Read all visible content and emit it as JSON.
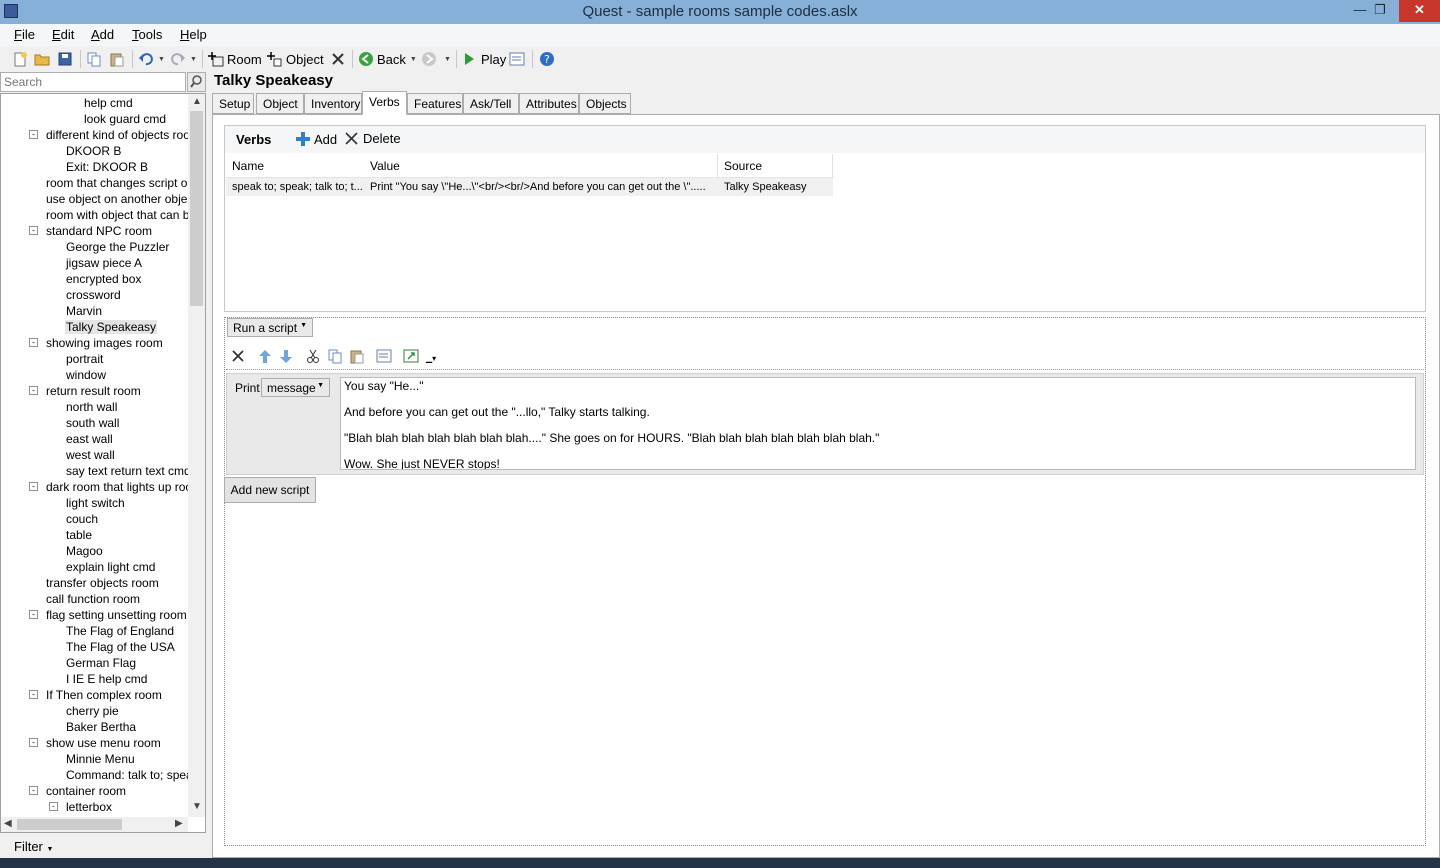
{
  "window": {
    "title": "Quest - sample rooms sample codes.aslx",
    "minimize": "—",
    "maximize": "❐",
    "close": "✕"
  },
  "menu": [
    {
      "acc": "F",
      "rest": "ile"
    },
    {
      "acc": "E",
      "rest": "dit"
    },
    {
      "acc": "A",
      "rest": "dd"
    },
    {
      "acc": "T",
      "rest": "ools"
    },
    {
      "acc": "H",
      "rest": "elp"
    }
  ],
  "toolbar": {
    "room_label": "Room",
    "object_label": "Object",
    "back_label": "Back",
    "play_label": "Play"
  },
  "search": {
    "placeholder": "Search"
  },
  "tree": [
    {
      "label": "help cmd",
      "level": 3
    },
    {
      "label": "look guard cmd",
      "level": 3
    },
    {
      "label": "different kind of objects room",
      "level": 1,
      "expander": "-"
    },
    {
      "label": "DKOOR B",
      "level": 2
    },
    {
      "label": "Exit: DKOOR B",
      "level": 2
    },
    {
      "label": "room that changes script once",
      "level": 1
    },
    {
      "label": "use object on another object n",
      "level": 1
    },
    {
      "label": "room with object that can be s",
      "level": 1
    },
    {
      "label": "standard NPC room",
      "level": 1,
      "expander": "-"
    },
    {
      "label": "George the Puzzler",
      "level": 2
    },
    {
      "label": "jigsaw piece A",
      "level": 2
    },
    {
      "label": "encrypted box",
      "level": 2
    },
    {
      "label": "crossword",
      "level": 2
    },
    {
      "label": "Marvin",
      "level": 2
    },
    {
      "label": "Talky Speakeasy",
      "level": 2,
      "selected": true
    },
    {
      "label": "showing images room",
      "level": 1,
      "expander": "-"
    },
    {
      "label": "portrait",
      "level": 2
    },
    {
      "label": "window",
      "level": 2
    },
    {
      "label": "return result room",
      "level": 1,
      "expander": "-"
    },
    {
      "label": "north wall",
      "level": 2
    },
    {
      "label": "south wall",
      "level": 2
    },
    {
      "label": "east wall",
      "level": 2
    },
    {
      "label": "west wall",
      "level": 2
    },
    {
      "label": "say text return text cmd",
      "level": 2
    },
    {
      "label": "dark room that lights up room",
      "level": 1,
      "expander": "-"
    },
    {
      "label": "light switch",
      "level": 2
    },
    {
      "label": "couch",
      "level": 2
    },
    {
      "label": "table",
      "level": 2
    },
    {
      "label": "Magoo",
      "level": 2
    },
    {
      "label": "explain light cmd",
      "level": 2
    },
    {
      "label": "transfer objects room",
      "level": 1
    },
    {
      "label": "call function room",
      "level": 1
    },
    {
      "label": "flag setting unsetting room",
      "level": 1,
      "expander": "-"
    },
    {
      "label": "The Flag of England",
      "level": 2
    },
    {
      "label": "The Flag of the USA",
      "level": 2
    },
    {
      "label": "German Flag",
      "level": 2
    },
    {
      "label": "I IE E help cmd",
      "level": 2
    },
    {
      "label": "If Then complex room",
      "level": 1,
      "expander": "-"
    },
    {
      "label": "cherry pie",
      "level": 2
    },
    {
      "label": "Baker Bertha",
      "level": 2
    },
    {
      "label": "show use menu room",
      "level": 1,
      "expander": "-"
    },
    {
      "label": "Minnie Menu",
      "level": 2
    },
    {
      "label": "Command: talk to; speak t",
      "level": 2
    },
    {
      "label": "container room",
      "level": 1,
      "expander": "-"
    },
    {
      "label": "letterbox",
      "level": 2,
      "expander": "-"
    }
  ],
  "filter": {
    "label": "Filter"
  },
  "element": {
    "title": "Talky Speakeasy"
  },
  "tabs": [
    "Setup",
    "Object",
    "Inventory",
    "Verbs",
    "Features",
    "Ask/Tell",
    "Attributes",
    "Objects"
  ],
  "active_tab": "Verbs",
  "verbs": {
    "title": "Verbs",
    "add_label": "Add",
    "delete_label": "Delete",
    "columns": [
      "Name",
      "Value",
      "Source"
    ],
    "rows": [
      [
        "speak to; speak; talk to; t...",
        "Print \"You say \\\"He...\\\"<br/><br/>And before you can get out the \\\".....",
        "Talky Speakeasy"
      ]
    ]
  },
  "script": {
    "run_label": "Run a script",
    "print_label": "Print",
    "print_mode": "message",
    "message_lines": [
      "You say \"He...\"",
      "And before you can get out the \"...llo,\" Talky starts talking.",
      "\"Blah blah blah blah blah blah blah....\"  She goes on for HOURS.  \"Blah blah blah blah blah blah blah.\"",
      "Wow.  She just NEVER stops!"
    ],
    "add_new_label": "Add new script"
  }
}
